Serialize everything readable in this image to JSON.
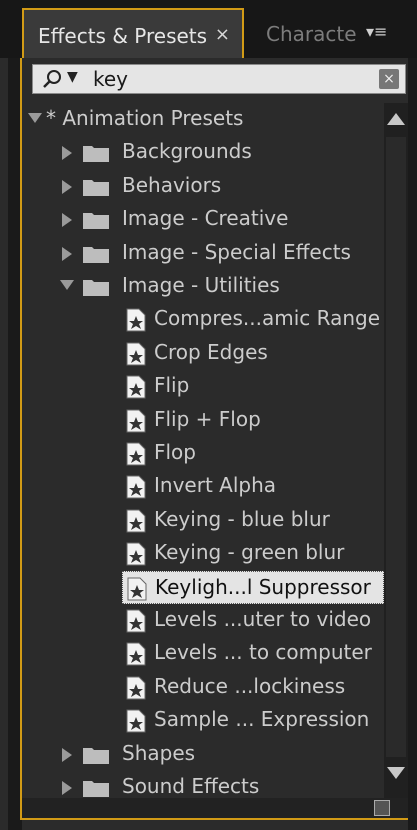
{
  "tabs": {
    "active_label": "Effects & Presets",
    "active_close": "×",
    "inactive_label": "Characte",
    "menu_glyph": "▾≡"
  },
  "search": {
    "caret": "▼",
    "query": "key",
    "clear": "×"
  },
  "tree": [
    {
      "label": "* Animation Presets",
      "type": "root",
      "expanded": true
    },
    {
      "label": "Backgrounds",
      "type": "folder",
      "expanded": false
    },
    {
      "label": "Behaviors",
      "type": "folder",
      "expanded": false
    },
    {
      "label": "Image - Creative",
      "type": "folder",
      "expanded": false
    },
    {
      "label": "Image - Special Effects",
      "type": "folder",
      "expanded": false
    },
    {
      "label": "Image - Utilities",
      "type": "folder",
      "expanded": true
    },
    {
      "label": "Compres...amic Range",
      "type": "preset"
    },
    {
      "label": "Crop Edges",
      "type": "preset"
    },
    {
      "label": "Flip",
      "type": "preset"
    },
    {
      "label": "Flip + Flop",
      "type": "preset"
    },
    {
      "label": "Flop",
      "type": "preset"
    },
    {
      "label": "Invert Alpha",
      "type": "preset"
    },
    {
      "label": "Keying - blue blur",
      "type": "preset"
    },
    {
      "label": "Keying - green blur",
      "type": "preset"
    },
    {
      "label": "Keyligh...l Suppressor",
      "type": "preset",
      "selected": true
    },
    {
      "label": "Levels ...uter to video",
      "type": "preset"
    },
    {
      "label": "Levels ... to computer",
      "type": "preset"
    },
    {
      "label": "Reduce ...lockiness",
      "type": "preset"
    },
    {
      "label": "Sample ... Expression",
      "type": "preset"
    },
    {
      "label": "Shapes",
      "type": "folder",
      "expanded": false
    },
    {
      "label": "Sound Effects",
      "type": "folder",
      "expanded": false
    }
  ],
  "colors": {
    "accent": "#d29b16",
    "panel_bg": "#2b2b2b",
    "text": "#cccccc",
    "selected_bg": "#e4e4e4"
  },
  "icons": [
    "search-icon",
    "folder-icon",
    "preset-icon",
    "expand-arrow-icon",
    "new-folder-icon",
    "panel-menu-icon"
  ]
}
